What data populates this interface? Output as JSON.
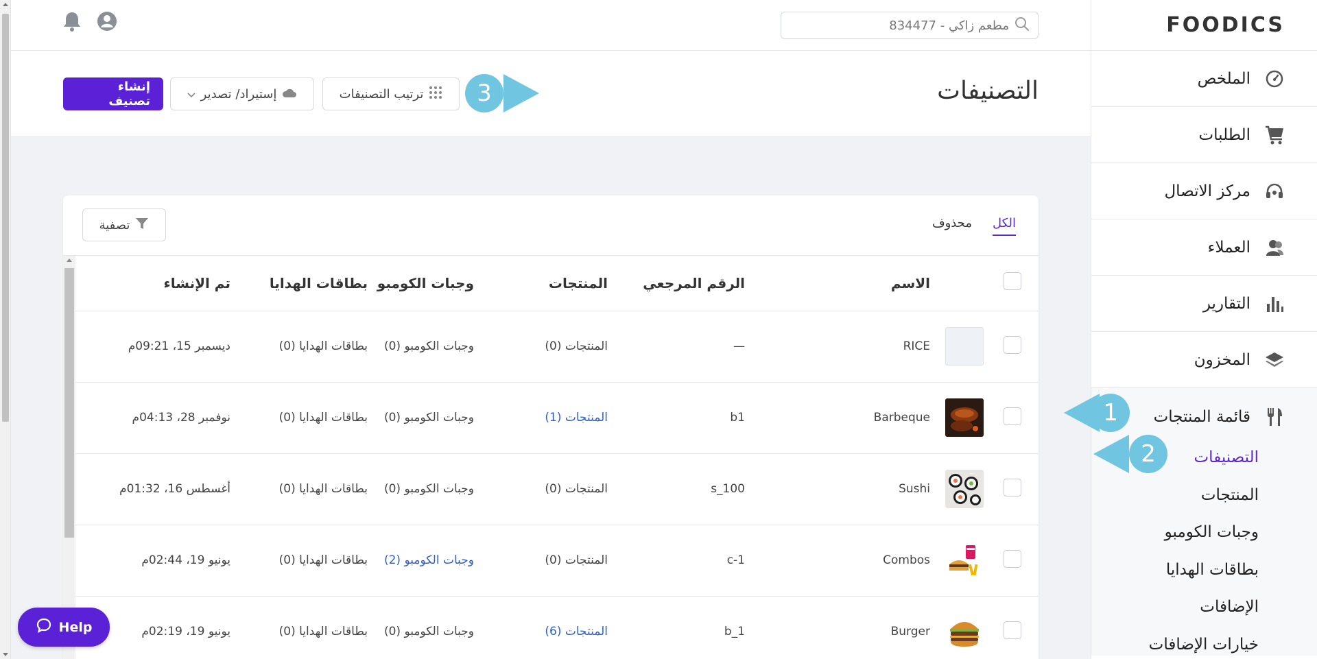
{
  "brand": {
    "logo_text": "FOODICS",
    "accent_color": "#5b21d6",
    "callout_color": "#70c6e0",
    "link_color": "#2f60c8"
  },
  "header": {
    "search_text": "مطعم زاكي - 834477",
    "icons": [
      "search-icon",
      "bell-icon",
      "user-icon"
    ]
  },
  "sidebar": {
    "items": [
      {
        "label": "الملخص",
        "icon": "dashboard-icon"
      },
      {
        "label": "الطلبات",
        "icon": "cart-icon"
      },
      {
        "label": "مركز الاتصال",
        "icon": "headset-icon"
      },
      {
        "label": "العملاء",
        "icon": "customers-icon"
      },
      {
        "label": "التقارير",
        "icon": "chart-icon"
      },
      {
        "label": "المخزون",
        "icon": "layers-icon"
      }
    ],
    "products_menu": {
      "label": "قائمة المنتجات",
      "icon": "utensils-icon",
      "subitems": [
        "التصنيفات",
        "المنتجات",
        "وجبات الكومبو",
        "بطاقات الهدايا",
        "الإضافات",
        "خيارات الإضافات"
      ],
      "active_index": 0
    }
  },
  "page": {
    "title": "التصنيفات",
    "buttons": {
      "create": "إنشاء تصنيف",
      "import_export": "إستيراد/ تصدير",
      "sort": "ترتيب التصنيفات"
    }
  },
  "callouts": [
    "1",
    "2",
    "3"
  ],
  "card": {
    "tabs": {
      "all": "الكل",
      "deleted": "محذوف"
    },
    "filter": "تصفية",
    "columns": [
      "الاسم",
      "الرقم المرجعي",
      "المنتجات",
      "وجبات الكومبو",
      "بطاقات الهدايا",
      "تم الإنشاء"
    ],
    "rows": [
      {
        "name": "RICE",
        "ref": "—",
        "products": "المنتجات (0)",
        "products_link": false,
        "combos": "وجبات الكومبو (0)",
        "combos_link": false,
        "gift_cards": "بطاقات الهدايا (0)",
        "created": "ديسمبر 15، 09:21م",
        "thumb": "empty"
      },
      {
        "name": "Barbeque",
        "ref": "b1",
        "products": "المنتجات (1)",
        "products_link": true,
        "combos": "وجبات الكومبو (0)",
        "combos_link": false,
        "gift_cards": "بطاقات الهدايا (0)",
        "created": "نوفمبر 28، 04:13م",
        "thumb": "bbq"
      },
      {
        "name": "Sushi",
        "ref": "s_100",
        "products": "المنتجات (0)",
        "products_link": false,
        "combos": "وجبات الكومبو (0)",
        "combos_link": false,
        "gift_cards": "بطاقات الهدايا (0)",
        "created": "أغسطس 16، 01:32م",
        "thumb": "sushi"
      },
      {
        "name": "Combos",
        "ref": "c-1",
        "products": "المنتجات (0)",
        "products_link": false,
        "combos": "وجبات الكومبو (2)",
        "combos_link": true,
        "gift_cards": "بطاقات الهدايا (0)",
        "created": "يونيو 19، 02:44م",
        "thumb": "combo"
      },
      {
        "name": "Burger",
        "ref": "b_1",
        "products": "المنتجات (6)",
        "products_link": true,
        "combos": "وجبات الكومبو (0)",
        "combos_link": false,
        "gift_cards": "بطاقات الهدايا (0)",
        "created": "يونيو 19، 02:19م",
        "thumb": "burger"
      }
    ]
  },
  "help": {
    "label": "Help"
  }
}
